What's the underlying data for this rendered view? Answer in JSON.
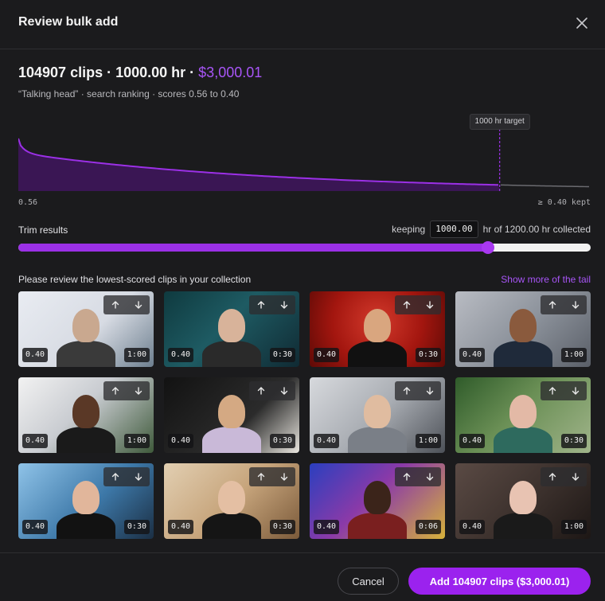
{
  "header": {
    "title": "Review bulk add"
  },
  "summary": {
    "clips": "104907 clips",
    "sep1": " · ",
    "hours": "1000.00 hr",
    "sep2": " · ",
    "price": "$3,000.01",
    "subline": "“Talking head” · search ranking · scores 0.56 to 0.40"
  },
  "chart_data": {
    "type": "area",
    "target_label": "1000 hr target",
    "x_min_label": "0.56",
    "x_max_label": "≥ 0.40 kept",
    "target_fraction": 0.841,
    "series_color": "#9b30e6"
  },
  "trim": {
    "label": "Trim results",
    "keeping_prefix": "keeping",
    "keeping_value": "1000.00",
    "keeping_suffix": "hr of 1200.00 hr collected",
    "kept_fraction": 0.82
  },
  "review": {
    "label": "Please review the lowest-scored clips in your collection",
    "show_more": "Show more of the tail"
  },
  "clips": [
    {
      "score": "0.40",
      "duration": "1:00"
    },
    {
      "score": "0.40",
      "duration": "0:30"
    },
    {
      "score": "0.40",
      "duration": "0:30"
    },
    {
      "score": "0.40",
      "duration": "1:00"
    },
    {
      "score": "0.40",
      "duration": "1:00"
    },
    {
      "score": "0.40",
      "duration": "0:30"
    },
    {
      "score": "0.40",
      "duration": "1:00"
    },
    {
      "score": "0.40",
      "duration": "0:30"
    },
    {
      "score": "0.40",
      "duration": "0:30"
    },
    {
      "score": "0.40",
      "duration": "0:30"
    },
    {
      "score": "0.40",
      "duration": "0:06"
    },
    {
      "score": "0.40",
      "duration": "1:00"
    }
  ],
  "footer": {
    "cancel_label": "Cancel",
    "add_label": "Add 104907 clips ($3,000.01)"
  },
  "colors": {
    "accent": "#a855f7",
    "button": "#9b22ee",
    "background": "#1b1b1d"
  }
}
